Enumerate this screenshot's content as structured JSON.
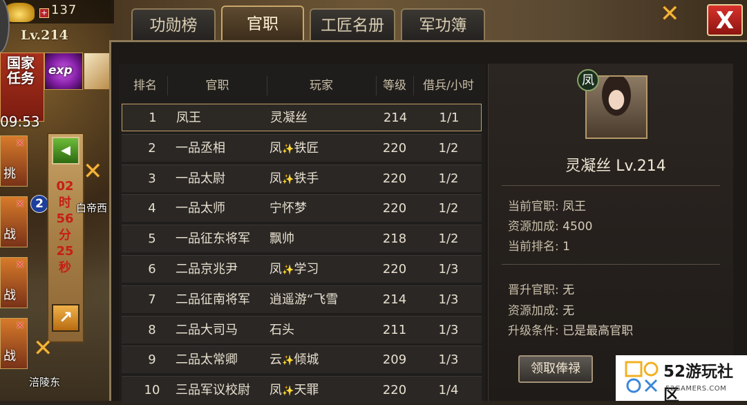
{
  "hud": {
    "gold": "137",
    "level": "Lv.214",
    "quest": "国家任务",
    "quest_timer": "09:53",
    "exp_label": "exp",
    "side_badge": "2",
    "countdown": [
      "02",
      "时",
      "56",
      "分",
      "25",
      "秒"
    ],
    "side_chars": [
      "挑",
      "战",
      "战",
      "战"
    ],
    "map_labels": [
      "白帝西",
      "涪陵东"
    ]
  },
  "tabs": [
    {
      "label": "功勋榜",
      "active": false
    },
    {
      "label": "官职",
      "active": true
    },
    {
      "label": "工匠名册",
      "active": false
    },
    {
      "label": "军功簿",
      "active": false
    }
  ],
  "close_label": "X",
  "table": {
    "headers": [
      "排名",
      "官职",
      "玩家",
      "等级",
      "借兵/小时"
    ],
    "rows": [
      {
        "rank": "1",
        "title": "凤王",
        "player": "灵凝丝",
        "sparkle": false,
        "level": "214",
        "troops": "1/1"
      },
      {
        "rank": "2",
        "title": "一品丞相",
        "player": "凤✨铁匠",
        "sparkle": true,
        "level": "220",
        "troops": "1/2"
      },
      {
        "rank": "3",
        "title": "一品太尉",
        "player": "凤✨铁手",
        "sparkle": true,
        "level": "220",
        "troops": "1/2"
      },
      {
        "rank": "4",
        "title": "一品太师",
        "player": "宁怀梦",
        "sparkle": false,
        "level": "220",
        "troops": "1/2"
      },
      {
        "rank": "5",
        "title": "一品征东将军",
        "player": "飘帅",
        "sparkle": false,
        "level": "218",
        "troops": "1/2"
      },
      {
        "rank": "6",
        "title": "二品京兆尹",
        "player": "凤✨学习",
        "sparkle": true,
        "level": "220",
        "troops": "1/3"
      },
      {
        "rank": "7",
        "title": "二品征南将军",
        "player": "逍遥游“飞雪",
        "sparkle": false,
        "level": "214",
        "troops": "1/3"
      },
      {
        "rank": "8",
        "title": "二品大司马",
        "player": "石头",
        "sparkle": false,
        "level": "211",
        "troops": "1/3"
      },
      {
        "rank": "9",
        "title": "二品太常卿",
        "player": "云✨倾城",
        "sparkle": true,
        "level": "209",
        "troops": "1/3"
      },
      {
        "rank": "10",
        "title": "三品军议校尉",
        "player": "凤✨天罪",
        "sparkle": true,
        "level": "220",
        "troops": "1/4"
      }
    ]
  },
  "detail": {
    "faction": "凤",
    "name_level": "灵凝丝  Lv.214",
    "current_title_label": "当前官职:",
    "current_title_value": "凤王",
    "resource_bonus_label": "资源加成:",
    "resource_bonus_value": "4500",
    "current_rank_label": "当前排名:",
    "current_rank_value": "1",
    "promote_title_label": "晋升官职:",
    "promote_title_value": "无",
    "promote_bonus_label": "资源加成:",
    "promote_bonus_value": "无",
    "upgrade_cond_label": "升级条件:",
    "upgrade_cond_value": "已是最高官职",
    "claim_button": "领取俸禄"
  },
  "watermark": {
    "big": "52游玩社区",
    "small": "52GAMERS.COM"
  }
}
